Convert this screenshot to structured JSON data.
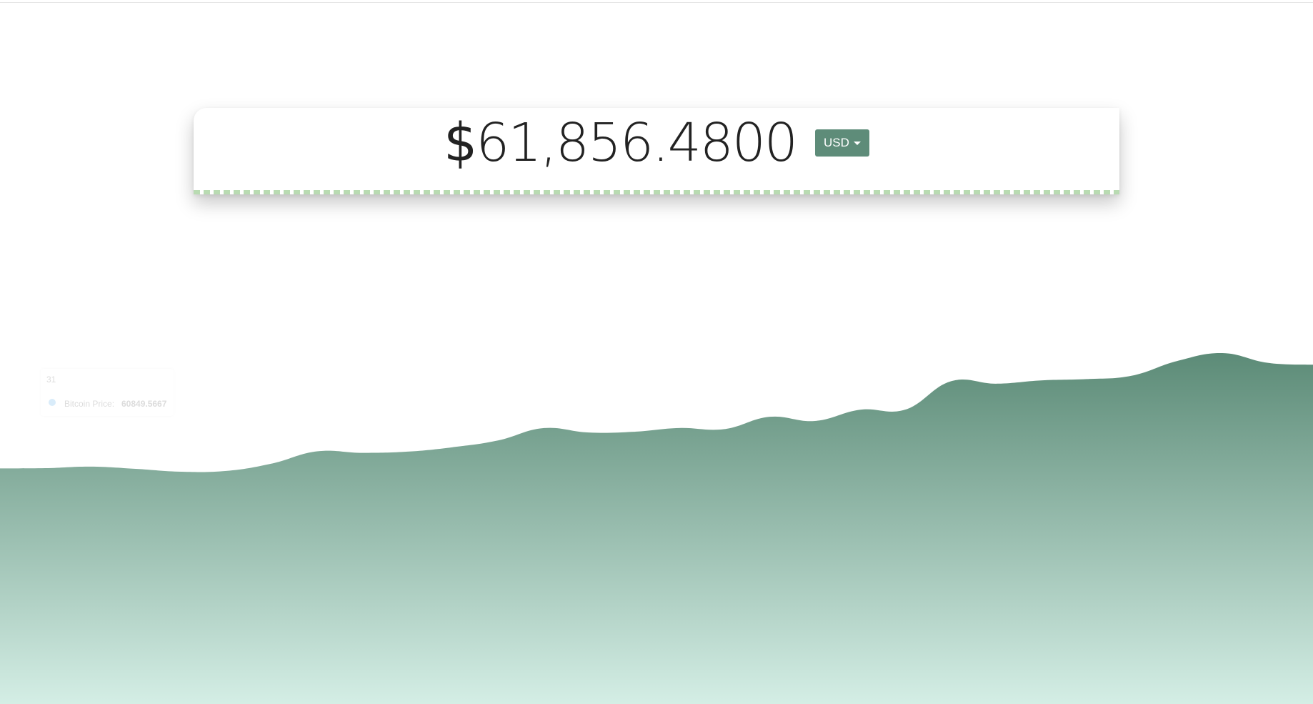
{
  "price": {
    "symbol": "$",
    "amount": "61,856.4800"
  },
  "currency": {
    "selected": "USD",
    "dropdown_icon": "caret-down"
  },
  "tooltip": {
    "date": "31",
    "series_label": "Bitcoin Price:",
    "value": "60849.5667"
  },
  "colors": {
    "accent": "#5e8c79",
    "area_top": "#5c8b77",
    "area_bottom": "#d4eee5",
    "dash": "#b9dbb2"
  },
  "chart_data": {
    "type": "area",
    "series": [
      {
        "values": [
          60849.57,
          60850.4,
          60856.6,
          60847.7,
          60836.3,
          60839.4,
          60868.7,
          60917.4,
          60911.6,
          60916.3,
          60934.0,
          60960.8,
          61010.1,
          60992.7,
          60995.6,
          61010.6,
          61006.1,
          61055.2,
          61038.6,
          61083.5,
          61084.0,
          61196.7,
          61187.2,
          61200.3,
          61205.4,
          61219.0,
          61277.6,
          61309.2,
          61270.3,
          61262.8
        ]
      }
    ],
    "ylim": [
      60000,
      62000
    ],
    "grid": false,
    "legend": "none"
  }
}
